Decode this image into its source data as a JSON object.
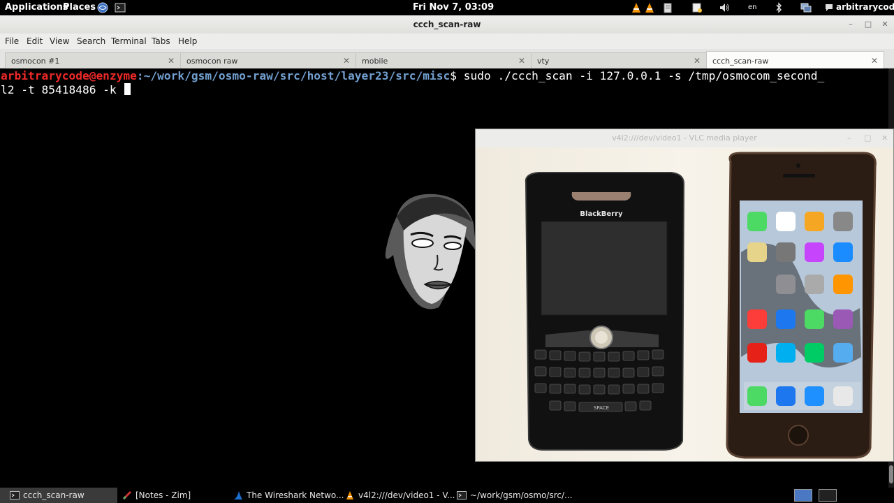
{
  "topbar": {
    "applications": "Applications",
    "places": "Places",
    "clock": "Fri Nov  7, 03:09",
    "keyboard_layout": "en",
    "username": "arbitrarycode",
    "icons": [
      "browser-icon",
      "terminal-launcher-icon",
      "vlc-cone-icon",
      "vlc-cone-icon",
      "clipboard-icon",
      "notes-icon",
      "volume-icon",
      "bluetooth-icon",
      "network-icon",
      "chat-icon"
    ]
  },
  "window": {
    "title": "ccch_scan-raw",
    "controls": [
      "minimize",
      "maximize",
      "close"
    ]
  },
  "menubar": {
    "items": [
      "File",
      "Edit",
      "View",
      "Search",
      "Terminal",
      "Tabs",
      "Help"
    ]
  },
  "tabs": [
    {
      "label": "osmocon #1",
      "active": false
    },
    {
      "label": "osmocon raw",
      "active": false
    },
    {
      "label": "mobile",
      "active": false
    },
    {
      "label": "vty",
      "active": false
    },
    {
      "label": "ccch_scan-raw",
      "active": true
    }
  ],
  "terminal": {
    "prompt_user": "arbitrarycode@enzyme",
    "prompt_path": ":~/work/gsm/osmo-raw/src/host/layer23/src/misc",
    "prompt_symbol": "$",
    "command_line1": " sudo ./ccch_scan -i 127.0.0.1 -s /tmp/osmocom_second_",
    "command_line2": "l2 -t 85418486 -k "
  },
  "vlc": {
    "title": "v4l2:///dev/video1 - VLC media player",
    "blackberry_label": "BlackBerry",
    "space_key": "SPACE"
  },
  "taskbar": {
    "tasks": [
      {
        "label": "ccch_scan-raw",
        "icon": "terminal-icon",
        "active": true
      },
      {
        "label": "[Notes - Zim]",
        "icon": "zim-icon",
        "active": false
      },
      {
        "label": "The Wireshark Netwo...",
        "icon": "wireshark-icon",
        "active": false
      },
      {
        "label": "v4l2:///dev/video1 - V...",
        "icon": "vlc-icon",
        "active": false
      },
      {
        "label": "~/work/gsm/osmo/src/...",
        "icon": "terminal-icon",
        "active": false
      }
    ]
  },
  "colors": {
    "prompt_user": "#ef2929",
    "prompt_path": "#729fcf",
    "terminal_bg": "#000000",
    "terminal_fg": "#ffffff"
  }
}
